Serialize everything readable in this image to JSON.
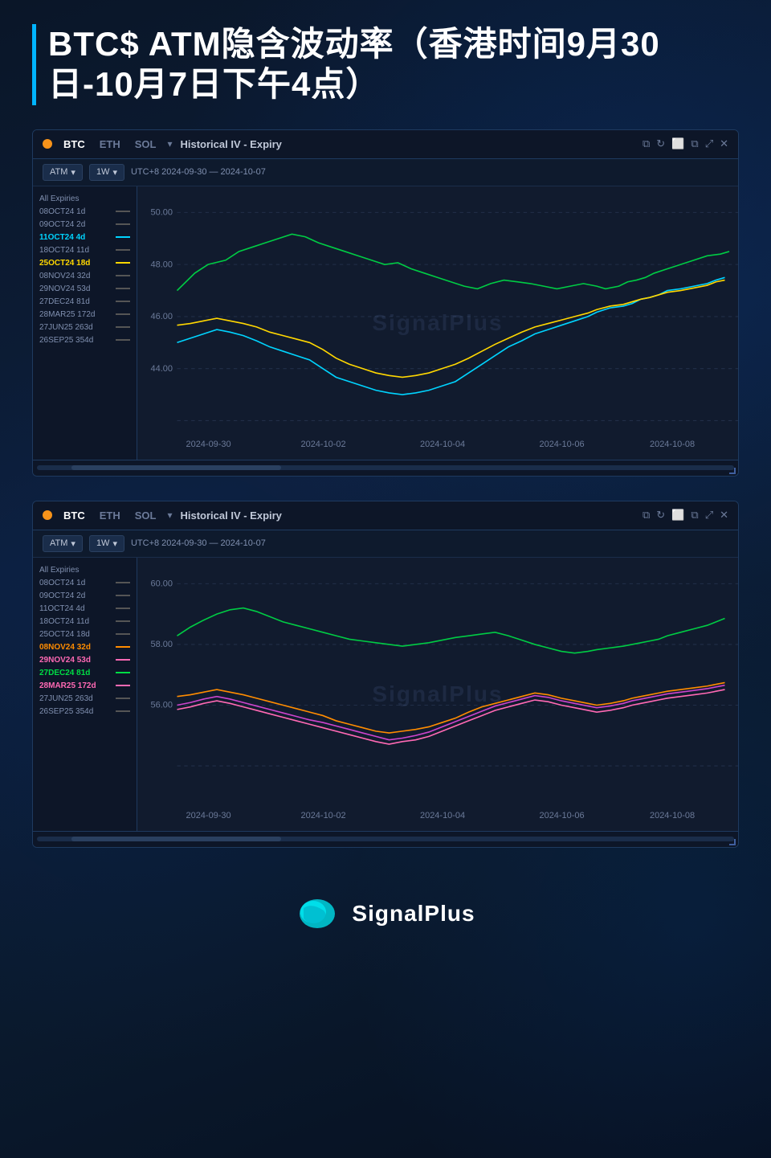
{
  "page": {
    "title": "BTC$ ATM隐含波动率（香港时间9月30日-10月7日下午4点）",
    "background_note": "SignalPlus branded crypto analytics page"
  },
  "chart1": {
    "coin_btc": "BTC",
    "coin_eth": "ETH",
    "coin_sol": "SOL",
    "chart_title": "Historical IV - Expiry",
    "timeframe": "1W",
    "timezone_range": "UTC+8 2024-09-30 — 2024-10-07",
    "type_selector": "ATM",
    "icons": [
      "external-link",
      "refresh",
      "1",
      "window",
      "expand",
      "close"
    ],
    "legend_items": [
      {
        "label": "All Expiries",
        "color": "none",
        "line": "none"
      },
      {
        "label": "08OCT24 1d",
        "color": "#888",
        "line": "gray"
      },
      {
        "label": "09OCT24 2d",
        "color": "#888",
        "line": "gray"
      },
      {
        "label": "11OCT24 4d",
        "color": "#00d4ff",
        "line": "cyan",
        "highlighted": true
      },
      {
        "label": "18OCT24 11d",
        "color": "#888",
        "line": "gray"
      },
      {
        "label": "25OCT24 18d",
        "color": "#ffd700",
        "line": "yellow",
        "highlighted": true
      },
      {
        "label": "08NOV24 32d",
        "color": "#888",
        "line": "gray"
      },
      {
        "label": "29NOV24 53d",
        "color": "#888",
        "line": "gray"
      },
      {
        "label": "27DEC24 81d",
        "color": "#888",
        "line": "gray"
      },
      {
        "label": "28MAR25 172d",
        "color": "#888",
        "line": "gray"
      },
      {
        "label": "27JUN25 263d",
        "color": "#888",
        "line": "gray"
      },
      {
        "label": "26SEP25 354d",
        "color": "#888",
        "line": "gray"
      }
    ],
    "y_axis": [
      "50.00",
      "48.00",
      "46.00",
      "44.00"
    ],
    "x_axis": [
      "2024-09-30",
      "2024-10-02",
      "2024-10-04",
      "2024-10-06",
      "2024-10-08"
    ],
    "watermark": "SignalPlus"
  },
  "chart2": {
    "coin_btc": "BTC",
    "coin_eth": "ETH",
    "coin_sol": "SOL",
    "chart_title": "Historical IV - Expiry",
    "timeframe": "1W",
    "timezone_range": "UTC+8 2024-09-30 — 2024-10-07",
    "type_selector": "ATM",
    "legend_items": [
      {
        "label": "All Expiries",
        "color": "none"
      },
      {
        "label": "08OCT24 1d",
        "color": "#888"
      },
      {
        "label": "09OCT24 2d",
        "color": "#888"
      },
      {
        "label": "11OCT24 4d",
        "color": "#888"
      },
      {
        "label": "18OCT24 11d",
        "color": "#888"
      },
      {
        "label": "25OCT24 18d",
        "color": "#888"
      },
      {
        "label": "08NOV24 32d",
        "color": "#ff8c00",
        "highlighted": true
      },
      {
        "label": "29NOV24 53d",
        "color": "#ff69b4",
        "highlighted2": true
      },
      {
        "label": "27DEC24 81d",
        "color": "#00dd44",
        "highlighted3": true
      },
      {
        "label": "28MAR25 172d",
        "color": "#ff69b4",
        "highlighted4": true
      },
      {
        "label": "27JUN25 263d",
        "color": "#888"
      },
      {
        "label": "26SEP25 354d",
        "color": "#888"
      }
    ],
    "y_axis": [
      "60.00",
      "58.00",
      "56.00"
    ],
    "x_axis": [
      "2024-09-30",
      "2024-10-02",
      "2024-10-04",
      "2024-10-06",
      "2024-10-08"
    ],
    "watermark": "SignalPlus"
  },
  "footer": {
    "logo_text": "SignalPlus",
    "logo_alt": "SignalPlus logo"
  },
  "icons": {
    "external_link": "⧉",
    "refresh": "↻",
    "number_1": "①",
    "window": "▣",
    "expand": "⤢",
    "close": "✕",
    "arrow_down": "▾"
  }
}
